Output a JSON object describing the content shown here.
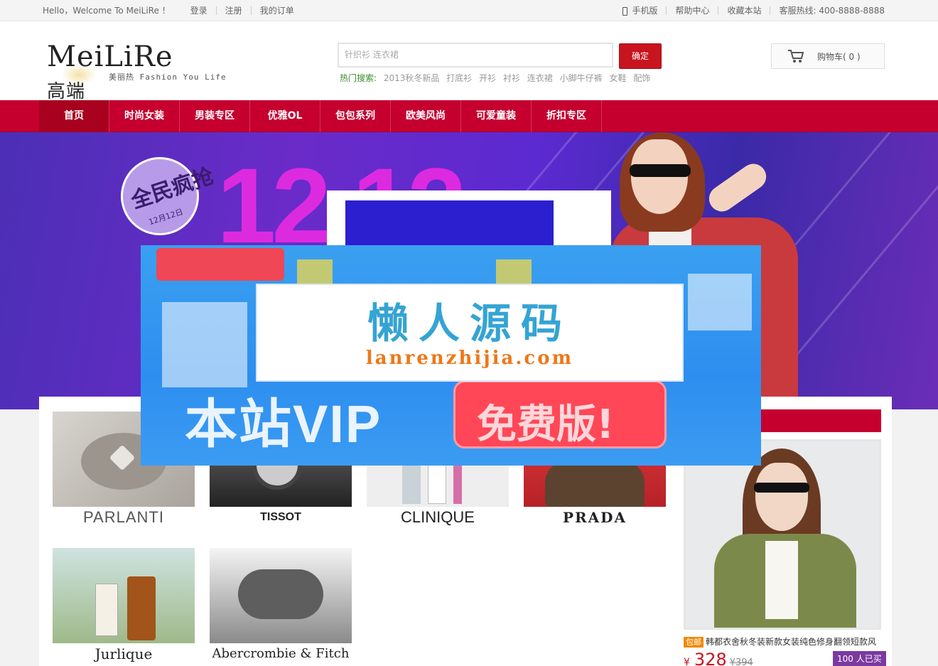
{
  "topbar": {
    "welcome": "Hello，Welcome To MeiLiRe ！",
    "login": "登录",
    "register": "注册",
    "orders": "我的订单",
    "mobile": "手机版",
    "help": "帮助中心",
    "favorite": "收藏本站",
    "hotline": "客服热线: 400-8888-8888"
  },
  "header": {
    "logo_brand": "MeiLiRe",
    "logo_cn": "高端",
    "logo_sub": "美丽热 Fashion You Life",
    "search_placeholder": "针织衫 连衣裙",
    "search_button": "确定",
    "hot_label": "热门搜索:",
    "hot_keywords": [
      "2013秋冬新品",
      "打底衫",
      "开衫",
      "衬衫",
      "连衣裙",
      "小脚牛仔裤",
      "女鞋",
      "配饰"
    ],
    "cart_label": "购物车( 0 )"
  },
  "nav": {
    "items": [
      "首页",
      "时尚女装",
      "男装专区",
      "优雅OL",
      "包包系列",
      "欧美风尚",
      "可爱童装",
      "折扣专区"
    ],
    "active_index": 0
  },
  "banner": {
    "big_number": "12.12",
    "badge_main": "全民疯抢",
    "badge_date": "12月12日"
  },
  "watermark": {
    "title_cn": "懒人源码",
    "title_en": "lanrenzhijia.com",
    "vip_text": "本站VIP"
  },
  "brands": [
    {
      "name": "PARLANTI"
    },
    {
      "name": "TISSOT"
    },
    {
      "name": "CLINIQUE"
    },
    {
      "name": "PRADA"
    },
    {
      "name": "Jurlique"
    },
    {
      "name": "Abercrombie & Fitch"
    }
  ],
  "featured": {
    "tag": "包邮",
    "title": "韩都衣舍秋冬装新款女装纯色修身翻领短款风",
    "currency": "¥",
    "price": "328",
    "old_price": "¥394",
    "sold": "100 人已买"
  },
  "colors": {
    "brand_red": "#c5002f",
    "button_red": "#c8141f",
    "hot_green": "#3a8c2a",
    "watermark_blue": "#2e8ef0"
  }
}
